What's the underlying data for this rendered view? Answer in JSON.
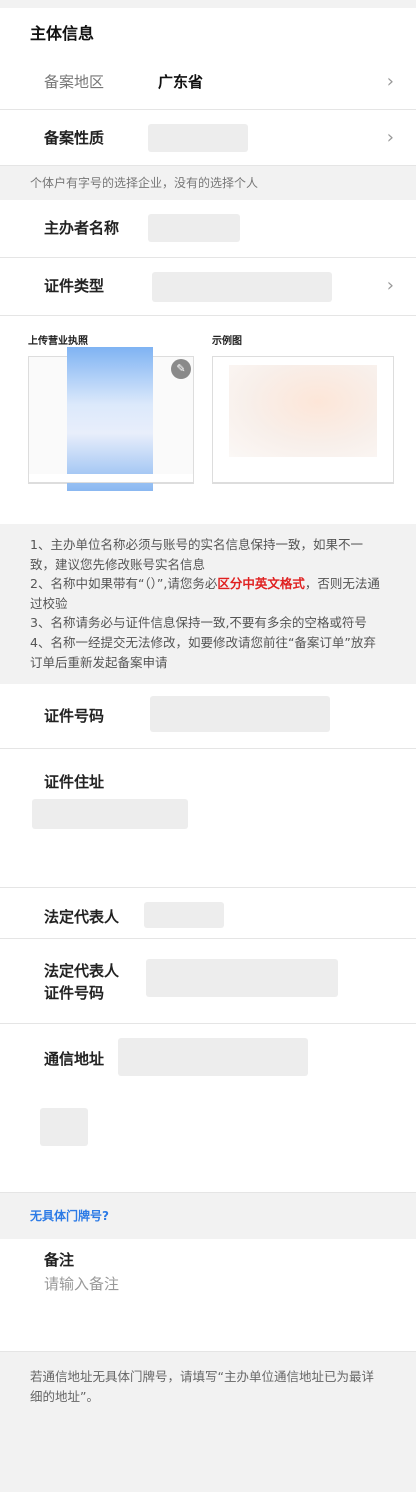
{
  "section": {
    "title": "主体信息"
  },
  "region": {
    "label": "备案地区",
    "value": "广东省"
  },
  "nature": {
    "label": "备案性质"
  },
  "nature_hint": "个体户有字号的选择企业，没有的选择个人",
  "sponsor": {
    "label": "主办者名称"
  },
  "cert_type": {
    "label": "证件类型"
  },
  "upload": {
    "label": "上传营业执照",
    "example_label": "示例图"
  },
  "notes": {
    "line1": "1、主办单位名称必须与账号的实名信息保持一致，如果不一致，建议您先修改账号实名信息",
    "line2_pre": "2、名称中如果带有“（）”,请您务必",
    "line2_red": "区分中英文格式",
    "line2_post": "，否则无法通过校验",
    "line3": "3、名称请务必与证件信息保持一致,不要有多余的空格或符号",
    "line4": "4、名称一经提交无法修改，如要修改请您前往“备案订单”放弃订单后重新发起备案申请"
  },
  "cert_no": {
    "label": "证件号码"
  },
  "cert_addr": {
    "label": "证件住址"
  },
  "legal_rep": {
    "label": "法定代表人"
  },
  "legal_rep_id": {
    "label_line1": "法定代表人",
    "label_line2": "证件号码"
  },
  "mail_addr": {
    "label": "通信地址"
  },
  "no_door_link": "无具体门牌号?",
  "remark": {
    "label": "备注",
    "placeholder": "请输入备注"
  },
  "footer_hint": "若通信地址无具体门牌号，请填写“主办单位通信地址已为最详细的地址”。",
  "icons": {
    "chevron": "chevron-right-icon",
    "edit": "pencil-icon"
  }
}
